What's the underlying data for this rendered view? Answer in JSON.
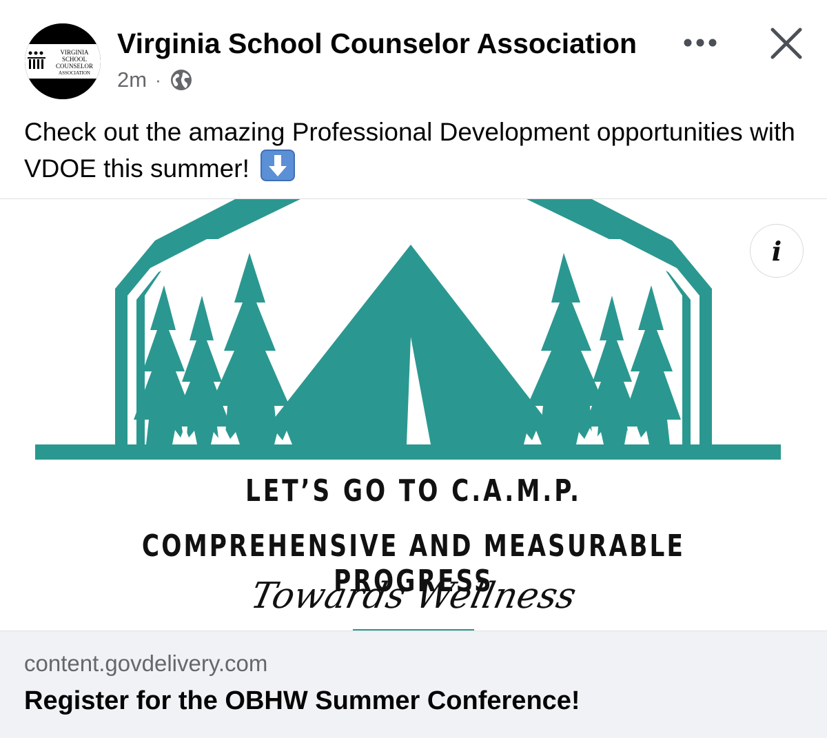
{
  "post": {
    "page_name": "Virginia School Counselor Association",
    "timestamp": "2m",
    "separator": "·",
    "audience_icon": "globe-icon",
    "caption": "Check out the amazing Professional Development opportunities with VDOE this summer!",
    "caption_emoji": "down-arrow-emoji"
  },
  "avatar": {
    "logo_line1": "VIRGINIA",
    "logo_line2": "SCHOOL",
    "logo_line3": "COUNSELOR",
    "logo_line4": "ASSOCIATION"
  },
  "media": {
    "headline": "LET’S GO TO C.A.M.P.",
    "subline": "COMPREHENSIVE AND MEASURABLE PROGRESS",
    "script": "Towards Wellness",
    "accent_color": "#2a9890",
    "info_icon": "info-icon"
  },
  "link": {
    "domain": "content.govdelivery.com",
    "title": "Register for the OBHW Summer Conference!"
  },
  "colors": {
    "text_primary": "#050505",
    "text_secondary": "#65676b",
    "card_bg": "#f0f2f5",
    "emoji_blue": "#4a90d9"
  }
}
